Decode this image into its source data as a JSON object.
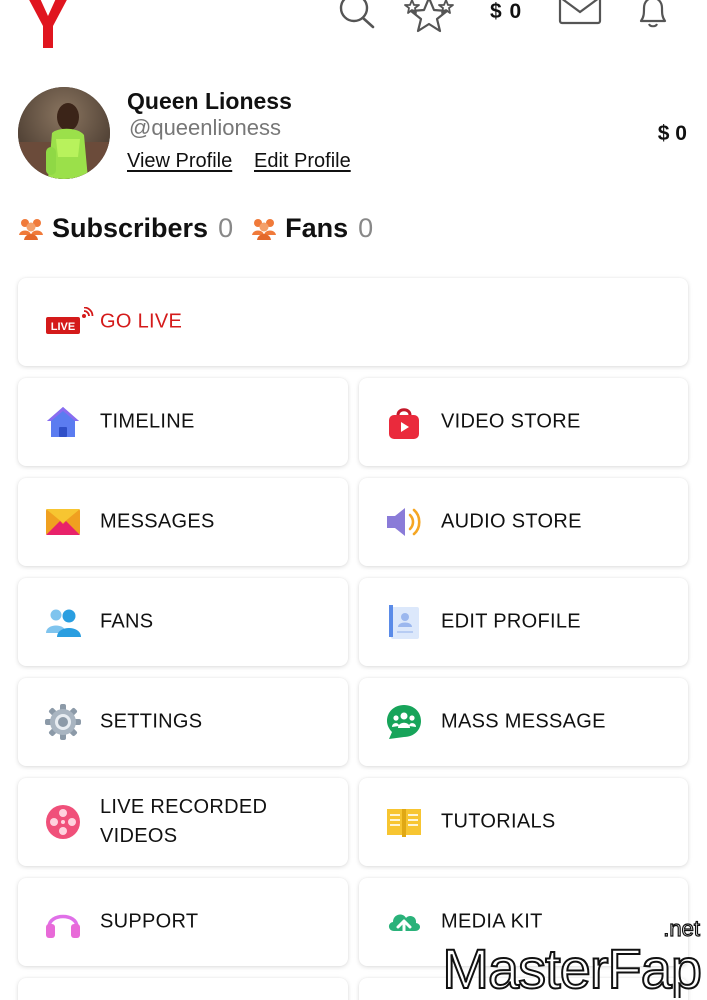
{
  "topbar": {
    "logo": "Y",
    "icons": [
      "search-icon",
      "stars-icon",
      "envelope-icon",
      "bell-icon"
    ],
    "money": "$ 0"
  },
  "profile": {
    "name": "Queen Lioness",
    "handle": "@queenlioness",
    "view_profile": "View Profile",
    "edit_profile": "Edit Profile",
    "balance": "$ 0"
  },
  "counters": {
    "subscribers_label": "Subscribers",
    "subscribers_value": "0",
    "fans_label": "Fans",
    "fans_value": "0"
  },
  "menu": {
    "go_live": {
      "badge": "LIVE",
      "label": "GO LIVE"
    },
    "items": [
      {
        "label": "TIMELINE",
        "icon": "home-icon"
      },
      {
        "label": "VIDEO STORE",
        "icon": "shopping-bag-icon"
      },
      {
        "label": "MESSAGES",
        "icon": "envelope-icon"
      },
      {
        "label": "AUDIO STORE",
        "icon": "speaker-icon"
      },
      {
        "label": "FANS",
        "icon": "users-icon"
      },
      {
        "label": "EDIT PROFILE",
        "icon": "profile-card-icon"
      },
      {
        "label": "SETTINGS",
        "icon": "gear-icon"
      },
      {
        "label": "MASS MESSAGE",
        "icon": "group-chat-icon"
      },
      {
        "label": "LIVE RECORDED VIDEOS",
        "icon": "film-reel-icon"
      },
      {
        "label": "TUTORIALS",
        "icon": "book-icon"
      },
      {
        "label": "SUPPORT",
        "icon": "headphones-icon"
      },
      {
        "label": "MEDIA KIT",
        "icon": "cloud-upload-icon"
      }
    ]
  },
  "watermark": {
    "text": "MasterFap",
    "suffix": ".net"
  },
  "colors": {
    "brand_red": "#e0151f",
    "live_red": "#d41a1a",
    "counter_orange": "#f07a3a"
  }
}
